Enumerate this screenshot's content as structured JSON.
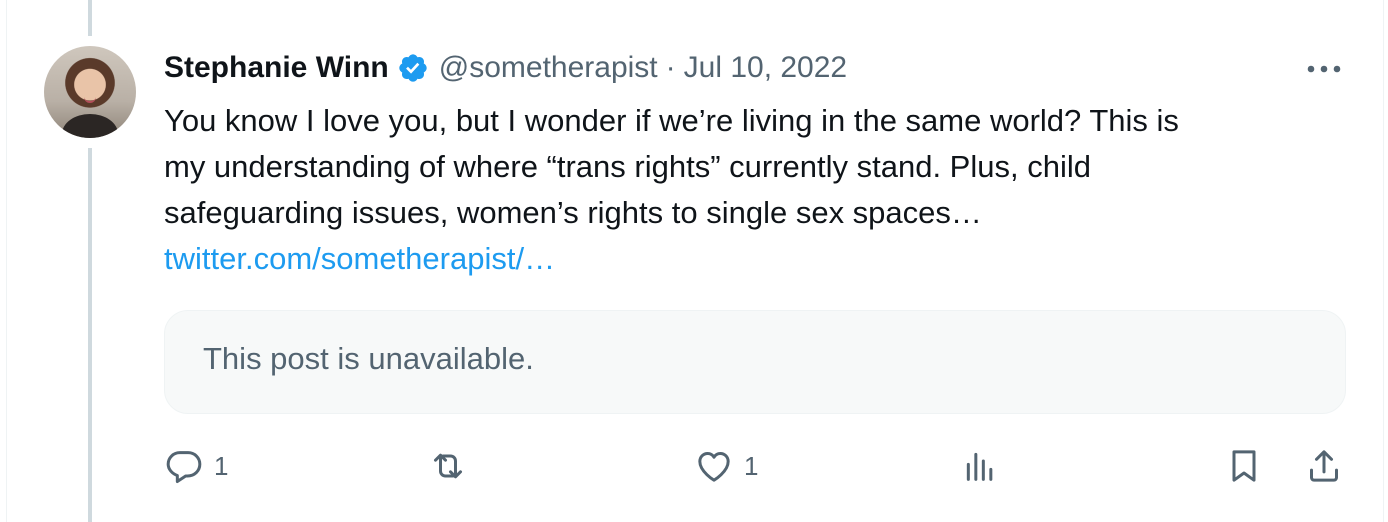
{
  "tweet": {
    "author_name": "Stephanie Winn",
    "handle": "@sometherapist",
    "separator": "·",
    "date": "Jul 10, 2022",
    "text_lines": [
      "You know I love you, but I wonder if we’re living in the same world? This is",
      "my understanding of where “trans rights” currently stand. Plus, child",
      "safeguarding issues, women’s rights to single sex spaces…"
    ],
    "link": "twitter.com/sometherapist/…",
    "quoted_notice": "This post is unavailable."
  },
  "actions": {
    "reply_count": "1",
    "like_count": "1"
  },
  "icons": [
    "verified-badge-icon",
    "more-icon",
    "reply-icon",
    "retweet-icon",
    "like-icon",
    "views-icon",
    "bookmark-icon",
    "share-icon"
  ],
  "colors": {
    "text": "#0f1419",
    "secondary": "#536471",
    "link": "#1d9bf0",
    "verified": "#1d9bf0",
    "thread_line": "#cfd9de",
    "card_bg": "#f7f9f9"
  }
}
